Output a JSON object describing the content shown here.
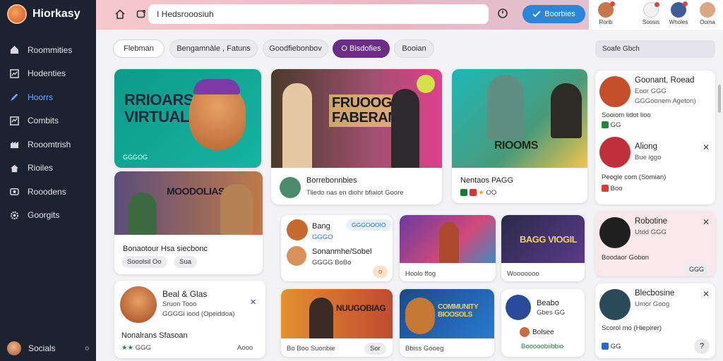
{
  "app": {
    "name": "Hiorkasy"
  },
  "sidebar": {
    "items": [
      {
        "label": "Roommities",
        "icon": "home-icon"
      },
      {
        "label": "Hodenties",
        "icon": "chart-icon"
      },
      {
        "label": "Hoorrs",
        "icon": "pen-icon",
        "active": true
      },
      {
        "label": "Combits",
        "icon": "graph-icon"
      },
      {
        "label": "Rooomtrish",
        "icon": "building-icon"
      },
      {
        "label": "Rioiles",
        "icon": "house-icon"
      },
      {
        "label": "Rooodens",
        "icon": "camera-icon"
      },
      {
        "label": "Goorgits",
        "icon": "gear-icon"
      }
    ],
    "footer": {
      "label": "Socials",
      "option": "o"
    }
  },
  "topbar": {
    "search_value": "I Hedsrooosiuh",
    "cta_label": "Boorbies",
    "users": [
      {
        "label": "Rorib",
        "color": "#c7774d"
      },
      {
        "label": "Soosis",
        "color": "#f2f2f2"
      },
      {
        "label": "Wholes",
        "color": "#3f5b9c"
      },
      {
        "label": "Ooma",
        "color": "#d9a883"
      }
    ]
  },
  "chips": [
    {
      "label": "Flebman"
    },
    {
      "label": "Bengamnàle ,  Fatuns"
    },
    {
      "label": "Goodfiebonbov"
    },
    {
      "label": "O Bisdofies",
      "active": true
    },
    {
      "label": "Booian"
    }
  ],
  "right_panel": {
    "search_placeholder": "Soafe Gbch",
    "cards": [
      {
        "name": "Goonant, Roead",
        "sub": "Eoor GGG",
        "sub2": "GGGoonem Ageton)",
        "line1": "Sooiom lidot lioo",
        "line2": "GG",
        "avatar": "#c44f2a"
      },
      {
        "name": "Aliong",
        "sub": "Bue iggo",
        "line1": "Peogle com (Somian)",
        "line2": "Boo"
      },
      {
        "name": "Robotine",
        "sub": "Utdd GGG",
        "line1": "Boodaor Gobon",
        "line2": "GGG"
      },
      {
        "name": "Blecbosine",
        "sub": "Umor Goog",
        "line1": "Scorol mo (Hiepirer)",
        "line2": "GG"
      }
    ]
  },
  "main": {
    "cards": [
      {
        "thumb_text": "RRIOARS VIRTUAL",
        "label": "GGGOG"
      },
      {
        "title": "Bonaotour Hsa siecbonc",
        "meta": "Sooolsil Oo",
        "pill": "Sua",
        "thumb_text": "MOODOLIAS"
      },
      {
        "title": "Borrebonnbies",
        "meta": "Tiiedo nas en diohr bfiaiot Goore",
        "thumb_text": "FRUOOG FABERAN"
      },
      {
        "title": "Nentaos PAGG",
        "meta": "OO",
        "thumb_text": "RIOOMS"
      },
      {
        "title": "Bang",
        "sub": "GGGO",
        "title2": "Sonanmhe/Sobel",
        "sub2": "GGGG BoBo",
        "badge": "GGGOOOIO",
        "pill": "o"
      },
      {
        "thumb_text": "",
        "meta": "Hoolo ffog"
      },
      {
        "thumb_text": "BAGG VIOGIL",
        "meta": "Wooooooo"
      },
      {
        "name": "Beal & Glas",
        "sub": "Sruon Tooo",
        "sub2": "GGGGi iood (Opeiddoa)",
        "line1": "Nonalrans Sfasoan",
        "stars": "GGG",
        "pill": "Aooo"
      },
      {
        "thumb_text": "NUUGOBIAG",
        "meta": "Bo Boo Suonbie",
        "pill": "Sor"
      },
      {
        "thumb_text": "COMMUNITY BIOOSOLS",
        "meta": "Bbiss Gooeg"
      },
      {
        "name": "Beabo",
        "sub": "Gbes GG",
        "name2": "Bolsee",
        "sub2": "Booooobiibbio"
      }
    ]
  }
}
